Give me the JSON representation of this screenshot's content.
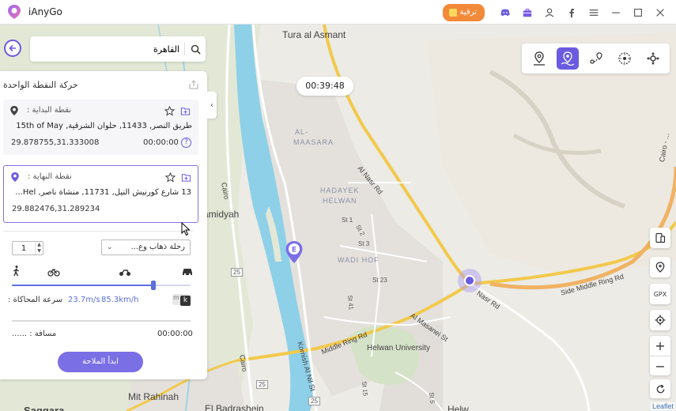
{
  "app": {
    "title": "iAnyGo",
    "upgrade_label": "ترقية"
  },
  "titlebar_icons": [
    "discord-icon",
    "toolbox-icon",
    "user-icon",
    "facebook-icon",
    "menu-icon",
    "minimize-icon",
    "maximize-icon",
    "close-icon"
  ],
  "search": {
    "value": "القاهرة",
    "placeholder": ""
  },
  "panel": {
    "title": "حركة النقطة الواحدة",
    "start": {
      "label": "نقطة البداية :",
      "address": "طريق النصر, 11433, حلوان الشرقية, 15th of May",
      "coords": "29.878755,31.333008",
      "time": "00:00:00"
    },
    "end": {
      "label": "نقطة النهاية :",
      "address": "13 شارع كورنيش النيل, 11731, منشأة ناصر, Hel...",
      "coords": "29.882476,31.289234"
    },
    "repeat_count": "1",
    "trip_type": "رحلة ذهاب وع...",
    "speed_label": "سرعة المحاكاة :",
    "speed_kmh": "85.3km/h",
    "speed_ms": "23.7m/s",
    "speed_fraction": 0.79,
    "unit_toggle": {
      "left": "m",
      "right": "k"
    },
    "distance_label": "مسافة :  ......",
    "elapsed": "00:00:00",
    "start_button": "ابدأ الملاحة"
  },
  "timer": "00:39:48",
  "map": {
    "labels": {
      "tura": "Tura al Asmant",
      "maasara1": "AL-",
      "maasara2": "MAASARA",
      "hadayek1": "HADAYEK",
      "hadayek2": "HELWAN",
      "wadi_hof": "WADI HOF",
      "hawamdiyah": "amidyah",
      "mit_rahinah": "Mit Rahinah",
      "badrashein": "El Badrashein",
      "saqqara": "Saqqara",
      "helwan_univ": "Helwan University",
      "nasr_rd1": "Al Nasr Rd",
      "nasr_rd2": "Nasr Rd",
      "middle_ring1": "Middle Ring Rd",
      "middle_ring2": "Side Middle Ring Rd",
      "masanei": "Al Masanei St",
      "kornish": "Kornish Al Nil St",
      "cairo1": "Cairo",
      "cairo2": "Cairo",
      "st1": "St 1",
      "st2": "St 2",
      "st3": "St 3",
      "st23": "St 23",
      "st41": "St 41",
      "st15": "St 15",
      "st5": "St 5",
      "r25a": "25",
      "r25b": "25",
      "r25c": "25",
      "cairo_east": "Cairo - ...",
      "helw": "Helw"
    }
  },
  "right_tools": {
    "gpx": "GPX",
    "zoom_in": "+",
    "zoom_out": "−"
  },
  "attribution": "Leaflet"
}
